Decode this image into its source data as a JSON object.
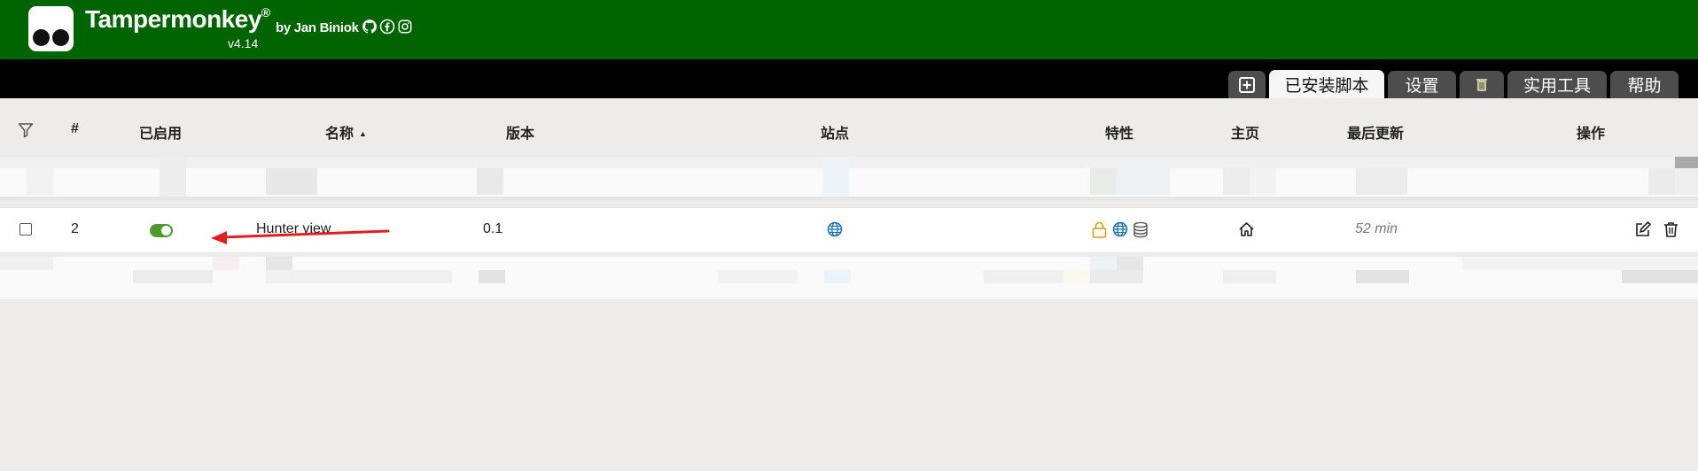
{
  "header": {
    "app_name": "Tampermonkey",
    "registered_mark": "®",
    "byline": "by Jan Biniok",
    "version": "v4.14",
    "social_icons": [
      "github-icon",
      "facebook-icon",
      "instagram-icon"
    ],
    "background_color": "#006400"
  },
  "tabs": [
    {
      "label": "",
      "icon": "add-script-icon",
      "active": false
    },
    {
      "label": "已安装脚本",
      "active": true
    },
    {
      "label": "设置",
      "active": false
    },
    {
      "label": "",
      "icon": "trash-icon",
      "active": false
    },
    {
      "label": "实用工具",
      "active": false
    },
    {
      "label": "帮助",
      "active": false
    }
  ],
  "table": {
    "filter_icon": "filter-icon",
    "columns": {
      "index": "#",
      "enabled": "已启用",
      "name": "名称",
      "version": "版本",
      "sites": "站点",
      "features": "特性",
      "homepage": "主页",
      "last_updated": "最后更新",
      "actions": "操作"
    },
    "sorted_by": "名称",
    "sort_direction": "ascending",
    "rows": [
      {
        "index": "2",
        "enabled": true,
        "name": "Hunter view",
        "version": "0.1",
        "sites": "globe-icon",
        "features": [
          "lock-icon",
          "globe-icon",
          "database-icon"
        ],
        "homepage": "home-icon",
        "last_updated": "52 min",
        "actions": [
          "edit-icon",
          "trash-icon"
        ]
      }
    ]
  },
  "colors": {
    "toggle_on": "#4d9a2c",
    "annotation_arrow": "#e02020",
    "tab_inactive": "#4d4d4d",
    "tab_bar": "#000000",
    "globe": "#1a73b8",
    "lock": "#d4a017"
  }
}
